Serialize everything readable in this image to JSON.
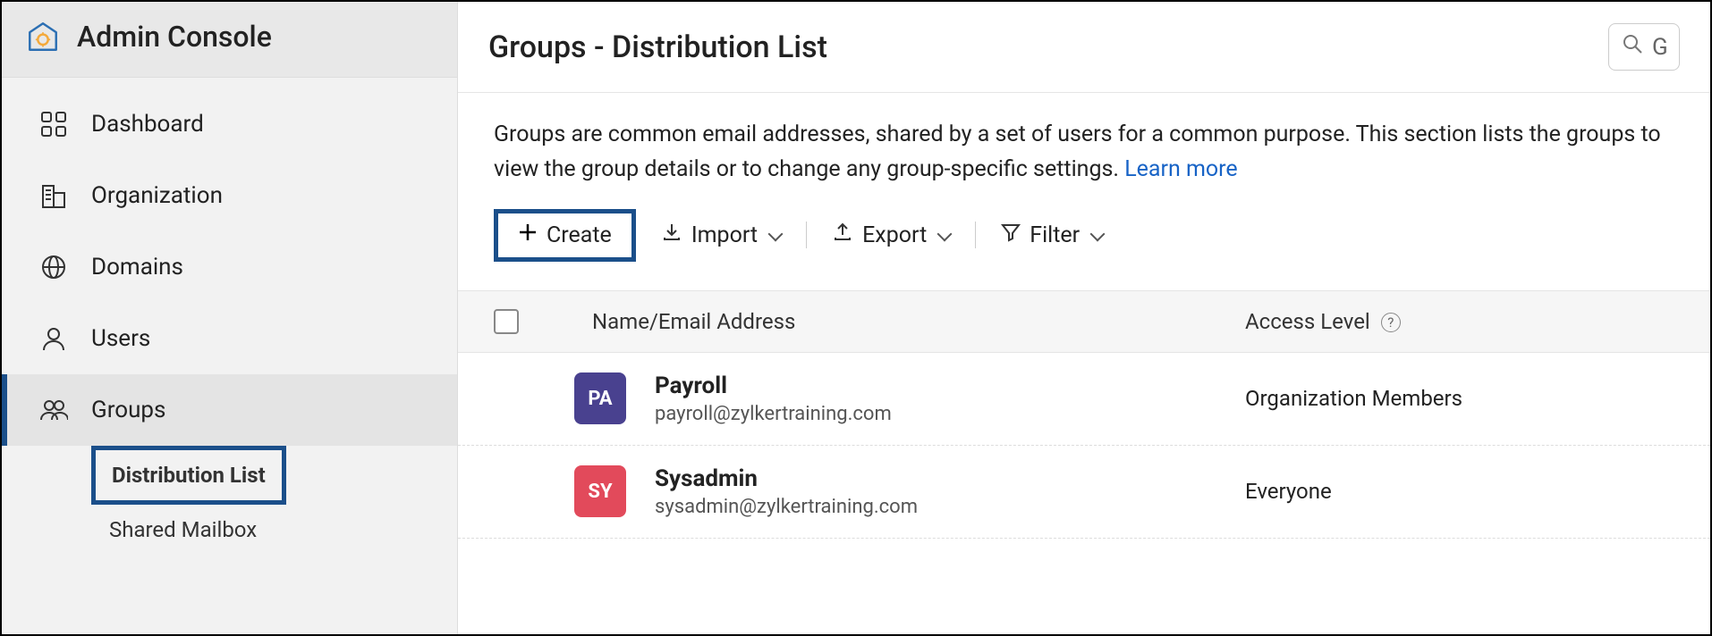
{
  "brand": {
    "title": "Admin Console"
  },
  "sidebar": {
    "items": [
      {
        "label": "Dashboard"
      },
      {
        "label": "Organization"
      },
      {
        "label": "Domains"
      },
      {
        "label": "Users"
      },
      {
        "label": "Groups"
      }
    ],
    "groups_sub": [
      {
        "label": "Distribution List",
        "highlight": true
      },
      {
        "label": "Shared Mailbox",
        "highlight": false
      }
    ]
  },
  "header": {
    "title": "Groups - Distribution List",
    "search_placeholder": "G"
  },
  "description": {
    "text": "Groups are common email addresses, shared by a set of users for a common purpose. This section lists the groups to view the group details or to change any group-specific settings.  ",
    "learn_more": "Learn more"
  },
  "toolbar": {
    "create": "Create",
    "import": "Import",
    "export": "Export",
    "filter": "Filter"
  },
  "table": {
    "headers": {
      "name": "Name/Email Address",
      "access": "Access Level"
    },
    "rows": [
      {
        "avatar_initials": "PA",
        "avatar_color": "#49418f",
        "name": "Payroll",
        "email": "payroll@zylkertraining.com",
        "access": "Organization Members"
      },
      {
        "avatar_initials": "SY",
        "avatar_color": "#e24a5b",
        "name": "Sysadmin",
        "email": "sysadmin@zylkertraining.com",
        "access": "Everyone"
      }
    ]
  }
}
